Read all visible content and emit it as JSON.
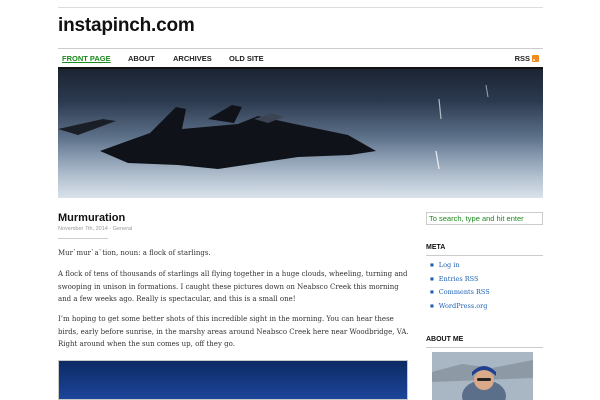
{
  "site": {
    "title": "instapinch.com"
  },
  "nav": {
    "items": [
      {
        "label": "FRONT PAGE",
        "active": true
      },
      {
        "label": "ABOUT"
      },
      {
        "label": "ARCHIVES"
      },
      {
        "label": "OLD SITE"
      }
    ],
    "rss_label": "RSS"
  },
  "post": {
    "title": "Murmuration",
    "date": "November 7th, 2014",
    "separator": " · ",
    "category": "General",
    "paragraphs": [
      "Mur`mur`a`tion,  noun:  a flock of starlings.",
      "A flock of tens of thousands of starlings all flying together in a huge clouds, wheeling, turning and swooping in unison in formations.  I caught these pictures down on Neabsco Creek this morning and a few weeks ago.  Really is spectacular, and this is a small one!",
      "I’m hoping to get some better shots of this incredible sight in the morning.  You can hear these birds, early before sunrise, in the marshy areas around Neabsco Creek here near Woodbridge, VA.  Right around when the sun comes up, off they go."
    ]
  },
  "sidebar": {
    "search_placeholder": "To search, type and hit enter",
    "meta_title": "META",
    "meta_links": [
      "Log in",
      "Entries RSS",
      "Comments RSS",
      "WordPress.org"
    ],
    "about_title": "ABOUT ME"
  },
  "colors": {
    "accent_green": "#1b8a1b",
    "link_blue": "#1b5fb3",
    "rss_orange": "#f28a1d"
  },
  "icons": {
    "rss": "rss-feed-icon",
    "list_bullet": "square-bullet-icon"
  }
}
